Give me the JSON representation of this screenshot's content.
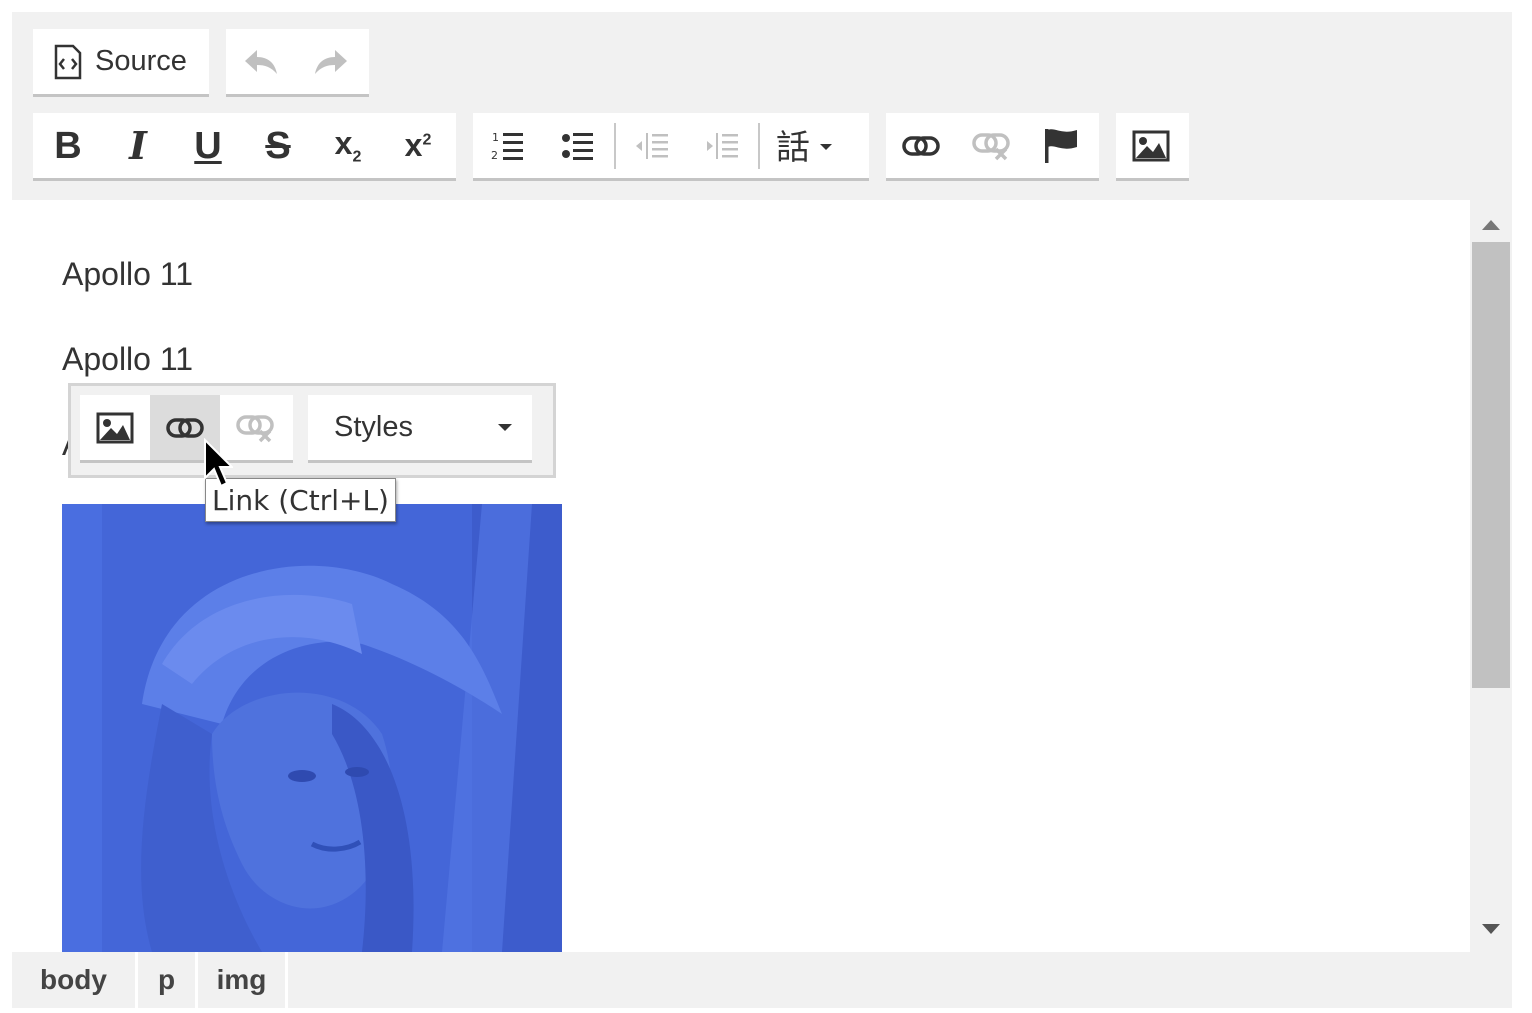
{
  "toolbar": {
    "source_label": "Source",
    "source_icon": "source-icon",
    "undo_icon": "undo-icon",
    "redo_icon": "redo-icon",
    "bold_label": "B",
    "italic_label": "I",
    "underline_label": "U",
    "strike_label": "S",
    "subscript_base": "x",
    "subscript_sub": "2",
    "superscript_base": "x",
    "superscript_sup": "2",
    "list_icons": [
      "numbered-list-icon",
      "bulleted-list-icon",
      "outdent-icon",
      "indent-icon",
      "language-icon"
    ],
    "link_icons": [
      "link-icon",
      "unlink-icon",
      "anchor-icon"
    ],
    "image_icon": "image-icon"
  },
  "content": {
    "paragraphs": [
      "Apollo 11",
      "Apollo 11"
    ],
    "image_icon": "photo"
  },
  "context_toolbar": {
    "image_icon": "image-icon",
    "link_icon": "link-icon",
    "unlink_icon": "unlink-icon",
    "styles_label": "Styles"
  },
  "tooltip": {
    "text": "Link (Ctrl+L)"
  },
  "statusbar": {
    "path": [
      "body",
      "p",
      "img"
    ]
  },
  "colors": {
    "toolbar_bg": "#f1f1f1",
    "image_tint": "#4466d8",
    "disabled": "#c0c0c0",
    "hover": "#dcdcdc"
  }
}
